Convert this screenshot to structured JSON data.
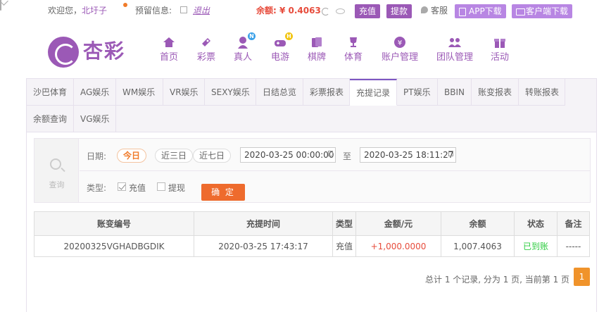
{
  "topbar": {
    "welcome": "欢迎您，",
    "username": "北圩子",
    "note_label": "预留信息:",
    "logout": "退出",
    "balance": "余额: ¥ 0.4063",
    "recharge": "充值",
    "withdraw": "提款",
    "service": "客服",
    "app_download": "APP下载",
    "client_download": "客户端下载"
  },
  "header": {
    "logo_text": "杏彩",
    "nav": [
      {
        "label": "首页",
        "icon": "home-icon"
      },
      {
        "label": "彩票",
        "icon": "lottery-icon"
      },
      {
        "label": "真人",
        "icon": "live-dealer-icon",
        "badge": "N"
      },
      {
        "label": "电游",
        "icon": "gamepad-icon",
        "badge": "H"
      },
      {
        "label": "棋牌",
        "icon": "cards-icon"
      },
      {
        "label": "体育",
        "icon": "trophy-icon"
      },
      {
        "label": "账户管理",
        "icon": "account-icon"
      },
      {
        "label": "团队管理",
        "icon": "team-icon"
      },
      {
        "label": "活动",
        "icon": "gift-icon"
      }
    ]
  },
  "tabs": [
    "沙巴体育",
    "AG娱乐",
    "WM娱乐",
    "VR娱乐",
    "SEXY娱乐",
    "日结总览",
    "彩票报表",
    "充提记录",
    "PT娱乐",
    "BBIN",
    "账变报表",
    "转账报表",
    "余额查询",
    "VG娱乐"
  ],
  "active_tab": "充提记录",
  "filter": {
    "query_label": "查询",
    "date_label": "日期:",
    "quick": [
      "今日",
      "近三日",
      "近七日"
    ],
    "start": "2020-03-25 00:00:00",
    "to": "至",
    "end": "2020-03-25 18:11:27",
    "type_label": "类型:",
    "types": [
      "充值",
      "提现"
    ],
    "confirm": "确 定"
  },
  "table": {
    "headers": [
      "账变编号",
      "充提时间",
      "类型",
      "金额/元",
      "余额",
      "状态",
      "备注"
    ],
    "rows": [
      [
        "20200325VGHADBGDIK",
        "2020-03-25 17:43:17",
        "充值",
        "+1,000.0000",
        "1,007.4063",
        "已到账",
        "-----"
      ]
    ]
  },
  "pager": {
    "summary": "总计 1 个记录, 分为 1 页, 当前第 1 页",
    "current": "1"
  },
  "colors": {
    "brand": "#9b59b6",
    "accent_orange": "#ee6b2d",
    "balance_red": "#e74c3c",
    "status_green": "#2ecc40"
  }
}
